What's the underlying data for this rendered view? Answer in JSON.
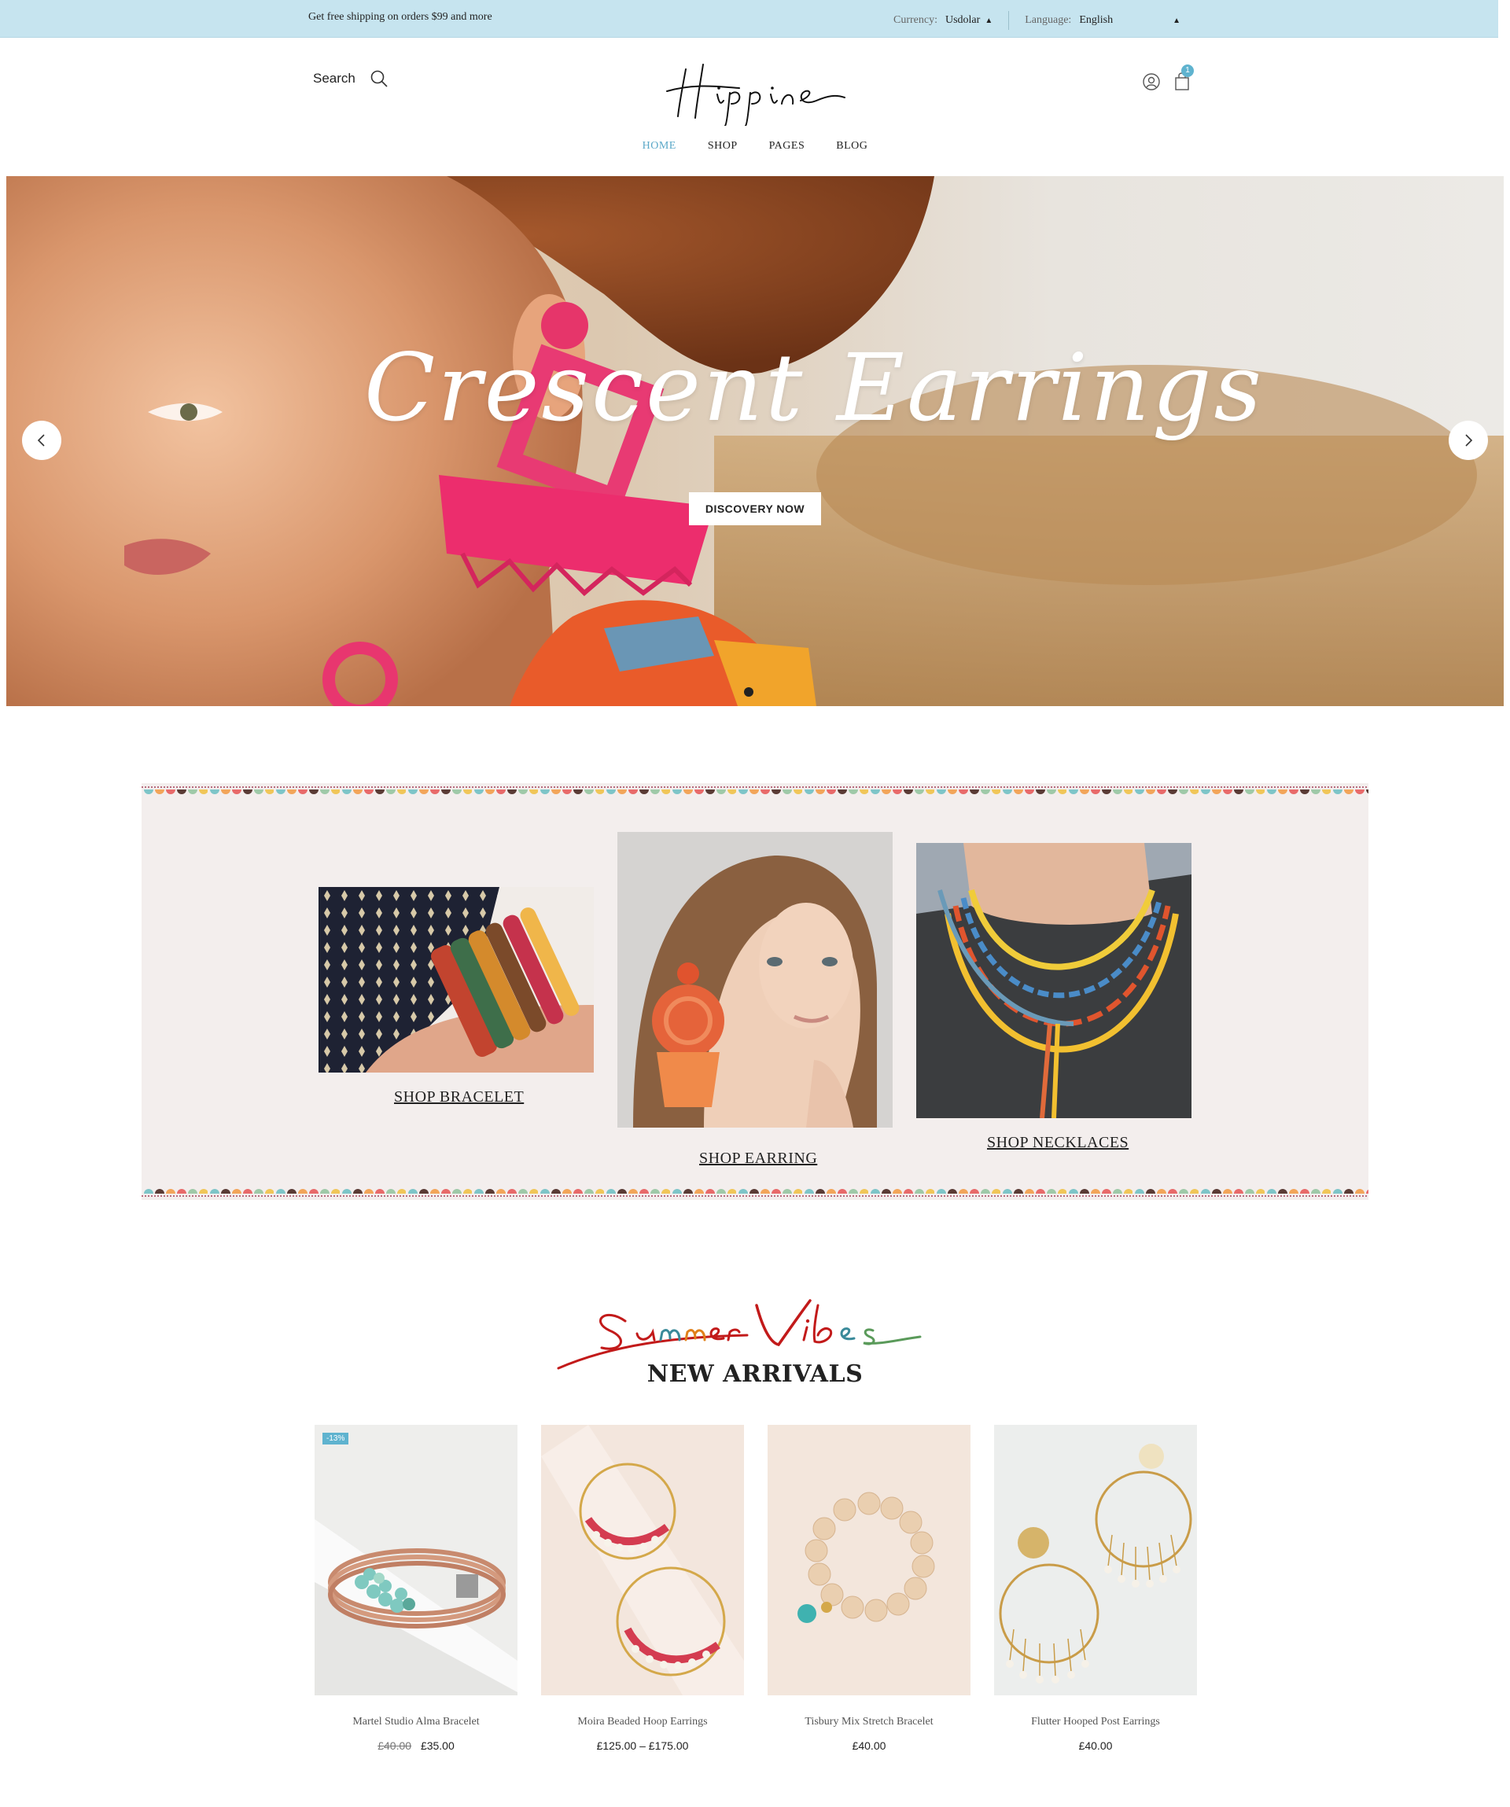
{
  "topbar": {
    "shipping_text": "Get free shipping on orders $99 and more",
    "currency_label": "Currency:",
    "currency_value": "Usdolar",
    "language_label": "Language:",
    "language_value": "English",
    "bg_color": "#c6e4ef"
  },
  "header": {
    "search_label": "Search",
    "logo_text": "Hippine",
    "cart_count": "1"
  },
  "nav": {
    "items": [
      {
        "label": "HOME",
        "active": true
      },
      {
        "label": "SHOP",
        "active": false
      },
      {
        "label": "PAGES",
        "active": false
      },
      {
        "label": "BLOG",
        "active": false
      }
    ],
    "active_color": "#5ba8c8"
  },
  "hero": {
    "title": "Crescent Earrings",
    "button_label": "DISCOVERY NOW"
  },
  "categories": [
    {
      "label": "SHOP BRACELET"
    },
    {
      "label": "SHOP EARRING"
    },
    {
      "label": "SHOP NECKLACES"
    }
  ],
  "arrivals": {
    "script_title": "Summer Vibes",
    "heading": "NEW ARRIVALS"
  },
  "products": [
    {
      "name": "Martel Studio Alma Bracelet",
      "old_price": "£40.00",
      "price": "£35.00",
      "badge": "-13%"
    },
    {
      "name": "Moira Beaded Hoop Earrings",
      "old_price": "",
      "price": "£125.00 – £175.00",
      "badge": ""
    },
    {
      "name": "Tisbury Mix Stretch Bracelet",
      "old_price": "",
      "price": "£40.00",
      "badge": ""
    },
    {
      "name": "Flutter Hooped Post Earrings",
      "old_price": "",
      "price": "£40.00",
      "badge": ""
    }
  ],
  "badge_color": "#5fb3cf"
}
